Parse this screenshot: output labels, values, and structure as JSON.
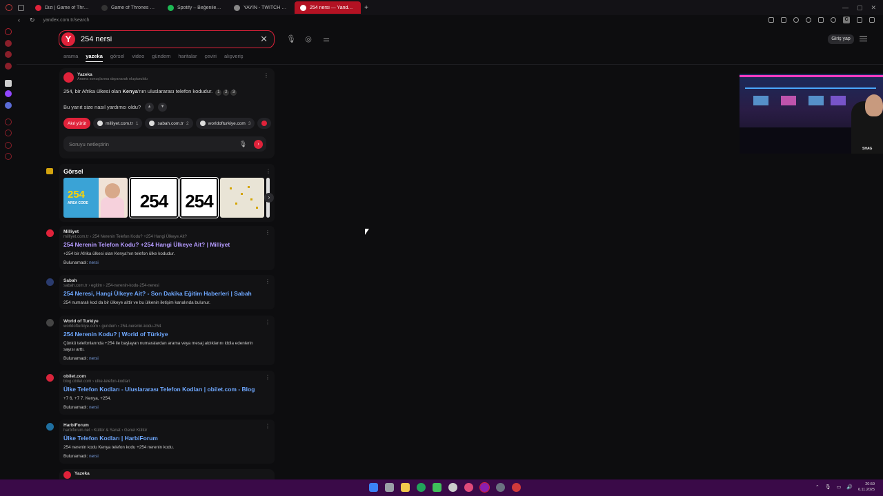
{
  "browser": {
    "tabs": [
      {
        "title": "Dizi | Game of Thrones",
        "color": "#e0223a",
        "active": false
      },
      {
        "title": "Game of Thrones 6.Sezon",
        "color": "#333333",
        "active": false
      },
      {
        "title": "Spotify – Beğenilen Şarkılar",
        "color": "#1db954",
        "active": false
      },
      {
        "title": "YAYIN - TWITCH FILM B",
        "color": "#888888",
        "active": false
      },
      {
        "title": "254 nersi — Yandex: 40 b",
        "color": "#ffffff",
        "active": true
      }
    ],
    "new_tab": "+",
    "url": "yandex.com.tr/search"
  },
  "search": {
    "logo": "Y",
    "query": "254 nersi",
    "clear": "✕",
    "login": "Giriş yap",
    "verticals": [
      "arama",
      "yazeka",
      "görsel",
      "video",
      "gündem",
      "haritalar",
      "çeviri",
      "alışveriş"
    ],
    "active_vertical": "yazeka"
  },
  "yazeka": {
    "title": "Yazeka",
    "subtitle": "Arama sonuçlarına dayanarak oluşturuldu",
    "answer_a": "254, bir Afrika ülkesi olan ",
    "answer_b": "Kenya",
    "answer_c": "'nın uluslararası telefon kodudur.",
    "refs": [
      "1",
      "2",
      "3"
    ],
    "feedback_q": "Bu yanıt size nasıl yardımcı oldu?",
    "chips": [
      {
        "label": "Akıl yürüt",
        "count": ""
      },
      {
        "label": "milliyet.com.tr",
        "count": "1"
      },
      {
        "label": "sabah.com.tr",
        "count": "2"
      },
      {
        "label": "worldofturkiye.com",
        "count": "3"
      }
    ],
    "refine_placeholder": "Soruyu netleştirin"
  },
  "images": {
    "title": "Görsel",
    "img1_big": "254",
    "img1_small": "AREA CODE",
    "img2_text": "254",
    "img3_text": "254"
  },
  "results": [
    {
      "source": "Milliyet",
      "path": "milliyet.com.tr › 254 Nerenin Telefon Kodu? +254 Hangi Ülkeye Ait?",
      "title": "254 Nerenin Telefon Kodu? +254 Hangi Ülkeye Ait? | Milliyet",
      "snippet": "+254 bir Afrika ülkesi olan Kenya'nın telefon ülke kodudur.",
      "missing_label": "Bulunamadı:",
      "missing_word": "nersi",
      "fav_color": "#e0223a",
      "visited": true
    },
    {
      "source": "Sabah",
      "path": "sabah.com.tr › egitim › 254-nerenin-kodu-254-neresi",
      "title": "254 Neresi, Hangi Ülkeye Ait? - Son Dakika Eğitim Haberleri | Sabah",
      "snippet": "254 numaralı kod da bir ülkeye aittir ve bu ülkenin iletişim kanalında bulunur.",
      "missing_label": "",
      "missing_word": "",
      "fav_color": "#2a3b6e",
      "visited": false
    },
    {
      "source": "World of Turkiye",
      "path": "worldofturkiye.com › gundem › 254-nerenin-kodu-254",
      "title": "254 Nerenin Kodu? | World of Türkiye",
      "snippet": "Çünkü telefonlarında +254 ile başlayan numaralardan arama veya mesaj aldıklarını iddia edenlerin sayısı arttı.",
      "missing_label": "Bulunamadı:",
      "missing_word": "nersi",
      "fav_color": "#444444",
      "visited": false
    },
    {
      "source": "obilet.com",
      "path": "blog.obilet.com › ulke-telefon-kodlari",
      "title": "Ülke Telefon Kodları - Uluslararası Telefon Kodları | obilet.com - Blog",
      "snippet": "+7 6, +7 7. Kenya, +254.",
      "missing_label": "Bulunamadı:",
      "missing_word": "nersi",
      "fav_color": "#d8243b",
      "visited": false
    },
    {
      "source": "HarbiForum",
      "path": "harbiforum.net › Kültür & Sanat › Genel Kültür",
      "title": "Ülke Telefon Kodları | HarbiForum",
      "snippet": "254 nerenin kodu Kenya telefon kodu +254 nerenin kodu.",
      "missing_label": "Bulunamadı:",
      "missing_word": "nersi",
      "fav_color": "#1f6fa0",
      "visited": false
    }
  ],
  "bottom_card": {
    "title": "Yazeka"
  },
  "overlay": {
    "logo": "SHAG"
  },
  "taskbar": {
    "time": "20:59",
    "date": "6.11.2025"
  }
}
